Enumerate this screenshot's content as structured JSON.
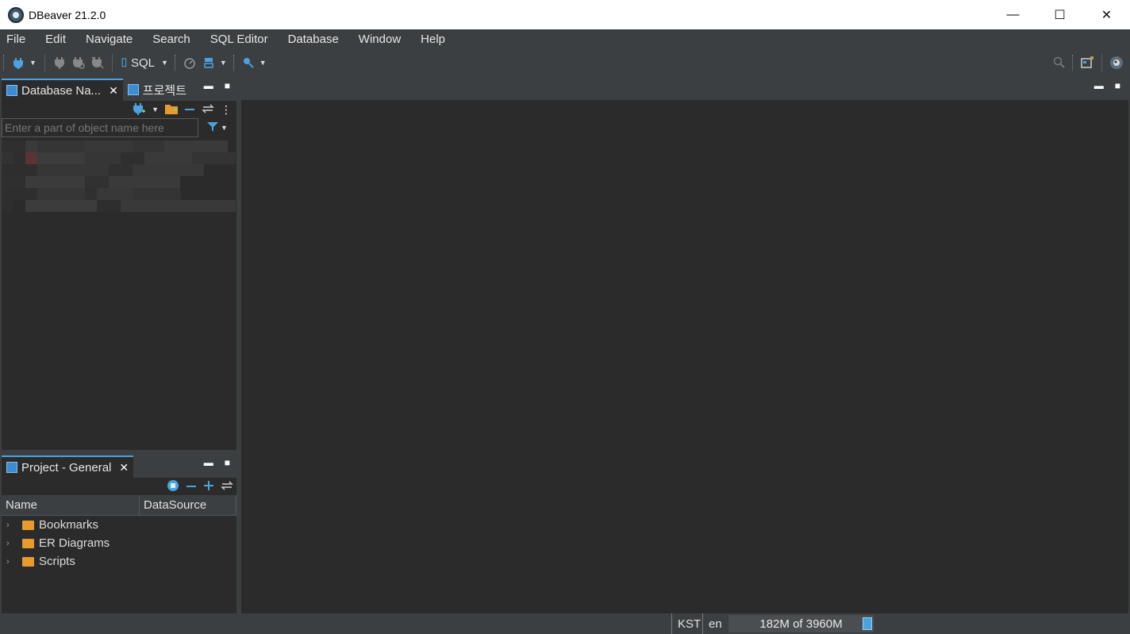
{
  "window": {
    "title": "DBeaver 21.2.0",
    "min_label": "—",
    "max_label": "☐",
    "close_label": "✕"
  },
  "menu": [
    "File",
    "Edit",
    "Navigate",
    "Search",
    "SQL Editor",
    "Database",
    "Window",
    "Help"
  ],
  "toolbar": {
    "sql_label": "SQL"
  },
  "navigator": {
    "tabs": [
      {
        "label": "Database Na...",
        "active": true
      },
      {
        "label": "프로젝트",
        "active": false
      }
    ],
    "filter_placeholder": "Enter a part of object name here"
  },
  "project": {
    "tab_label": "Project - General",
    "columns": [
      "Name",
      "DataSource"
    ],
    "items": [
      "Bookmarks",
      "ER Diagrams",
      "Scripts"
    ]
  },
  "status": {
    "timezone": "KST",
    "locale": "en",
    "memory": "182M of 3960M"
  },
  "colors": {
    "accent": "#4aa3df",
    "folder": "#e89a2c",
    "bg": "#2b2b2b",
    "chrome": "#3c3f41"
  }
}
